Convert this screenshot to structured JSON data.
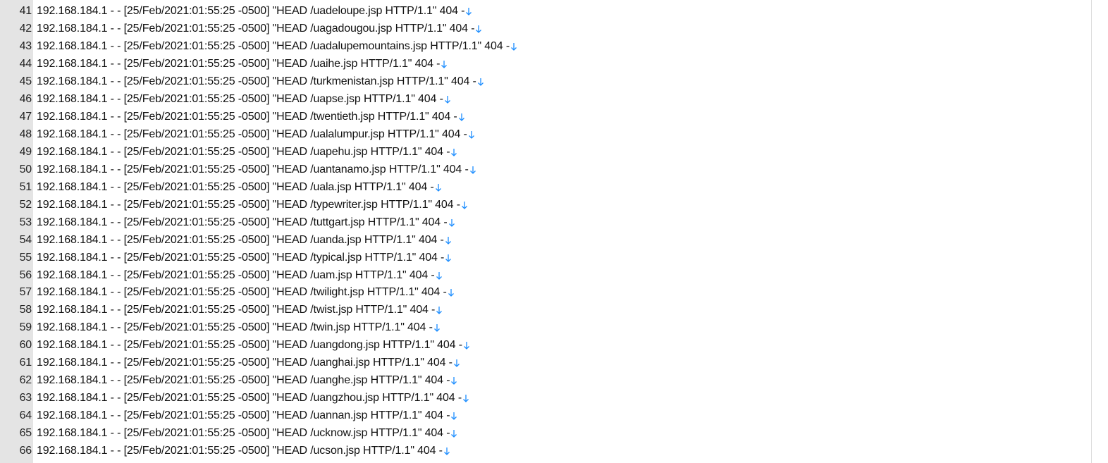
{
  "editor": {
    "eol_icon": "down-arrow-icon",
    "eol_color": "#1a8cff",
    "gutter_color": "#e4e4e4",
    "lines": [
      {
        "num": "41",
        "text": "192.168.184.1 - - [25/Feb/2021:01:55:25 -0500] \"HEAD /uadeloupe.jsp HTTP/1.1\" 404 -"
      },
      {
        "num": "42",
        "text": "192.168.184.1 - - [25/Feb/2021:01:55:25 -0500] \"HEAD /uagadougou.jsp HTTP/1.1\" 404 -"
      },
      {
        "num": "43",
        "text": "192.168.184.1 - - [25/Feb/2021:01:55:25 -0500] \"HEAD /uadalupemountains.jsp HTTP/1.1\" 404 -"
      },
      {
        "num": "44",
        "text": "192.168.184.1 - - [25/Feb/2021:01:55:25 -0500] \"HEAD /uaihe.jsp HTTP/1.1\" 404 -"
      },
      {
        "num": "45",
        "text": "192.168.184.1 - - [25/Feb/2021:01:55:25 -0500] \"HEAD /turkmenistan.jsp HTTP/1.1\" 404 -"
      },
      {
        "num": "46",
        "text": "192.168.184.1 - - [25/Feb/2021:01:55:25 -0500] \"HEAD /uapse.jsp HTTP/1.1\" 404 -"
      },
      {
        "num": "47",
        "text": "192.168.184.1 - - [25/Feb/2021:01:55:25 -0500] \"HEAD /twentieth.jsp HTTP/1.1\" 404 -"
      },
      {
        "num": "48",
        "text": "192.168.184.1 - - [25/Feb/2021:01:55:25 -0500] \"HEAD /ualalumpur.jsp HTTP/1.1\" 404 -"
      },
      {
        "num": "49",
        "text": "192.168.184.1 - - [25/Feb/2021:01:55:25 -0500] \"HEAD /uapehu.jsp HTTP/1.1\" 404 -"
      },
      {
        "num": "50",
        "text": "192.168.184.1 - - [25/Feb/2021:01:55:25 -0500] \"HEAD /uantanamo.jsp HTTP/1.1\" 404 -"
      },
      {
        "num": "51",
        "text": "192.168.184.1 - - [25/Feb/2021:01:55:25 -0500] \"HEAD /uala.jsp HTTP/1.1\" 404 -"
      },
      {
        "num": "52",
        "text": "192.168.184.1 - - [25/Feb/2021:01:55:25 -0500] \"HEAD /typewriter.jsp HTTP/1.1\" 404 -"
      },
      {
        "num": "53",
        "text": "192.168.184.1 - - [25/Feb/2021:01:55:25 -0500] \"HEAD /tuttgart.jsp HTTP/1.1\" 404 -"
      },
      {
        "num": "54",
        "text": "192.168.184.1 - - [25/Feb/2021:01:55:25 -0500] \"HEAD /uanda.jsp HTTP/1.1\" 404 -"
      },
      {
        "num": "55",
        "text": "192.168.184.1 - - [25/Feb/2021:01:55:25 -0500] \"HEAD /typical.jsp HTTP/1.1\" 404 -"
      },
      {
        "num": "56",
        "text": "192.168.184.1 - - [25/Feb/2021:01:55:25 -0500] \"HEAD /uam.jsp HTTP/1.1\" 404 -"
      },
      {
        "num": "57",
        "text": "192.168.184.1 - - [25/Feb/2021:01:55:25 -0500] \"HEAD /twilight.jsp HTTP/1.1\" 404 -"
      },
      {
        "num": "58",
        "text": "192.168.184.1 - - [25/Feb/2021:01:55:25 -0500] \"HEAD /twist.jsp HTTP/1.1\" 404 -"
      },
      {
        "num": "59",
        "text": "192.168.184.1 - - [25/Feb/2021:01:55:25 -0500] \"HEAD /twin.jsp HTTP/1.1\" 404 -"
      },
      {
        "num": "60",
        "text": "192.168.184.1 - - [25/Feb/2021:01:55:25 -0500] \"HEAD /uangdong.jsp HTTP/1.1\" 404 -"
      },
      {
        "num": "61",
        "text": "192.168.184.1 - - [25/Feb/2021:01:55:25 -0500] \"HEAD /uanghai.jsp HTTP/1.1\" 404 -"
      },
      {
        "num": "62",
        "text": "192.168.184.1 - - [25/Feb/2021:01:55:25 -0500] \"HEAD /uanghe.jsp HTTP/1.1\" 404 -"
      },
      {
        "num": "63",
        "text": "192.168.184.1 - - [25/Feb/2021:01:55:25 -0500] \"HEAD /uangzhou.jsp HTTP/1.1\" 404 -"
      },
      {
        "num": "64",
        "text": "192.168.184.1 - - [25/Feb/2021:01:55:25 -0500] \"HEAD /uannan.jsp HTTP/1.1\" 404 -"
      },
      {
        "num": "65",
        "text": "192.168.184.1 - - [25/Feb/2021:01:55:25 -0500] \"HEAD /ucknow.jsp HTTP/1.1\" 404 -"
      },
      {
        "num": "66",
        "text": "192.168.184.1 - - [25/Feb/2021:01:55:25 -0500] \"HEAD /ucson.jsp HTTP/1.1\" 404 -"
      }
    ]
  }
}
